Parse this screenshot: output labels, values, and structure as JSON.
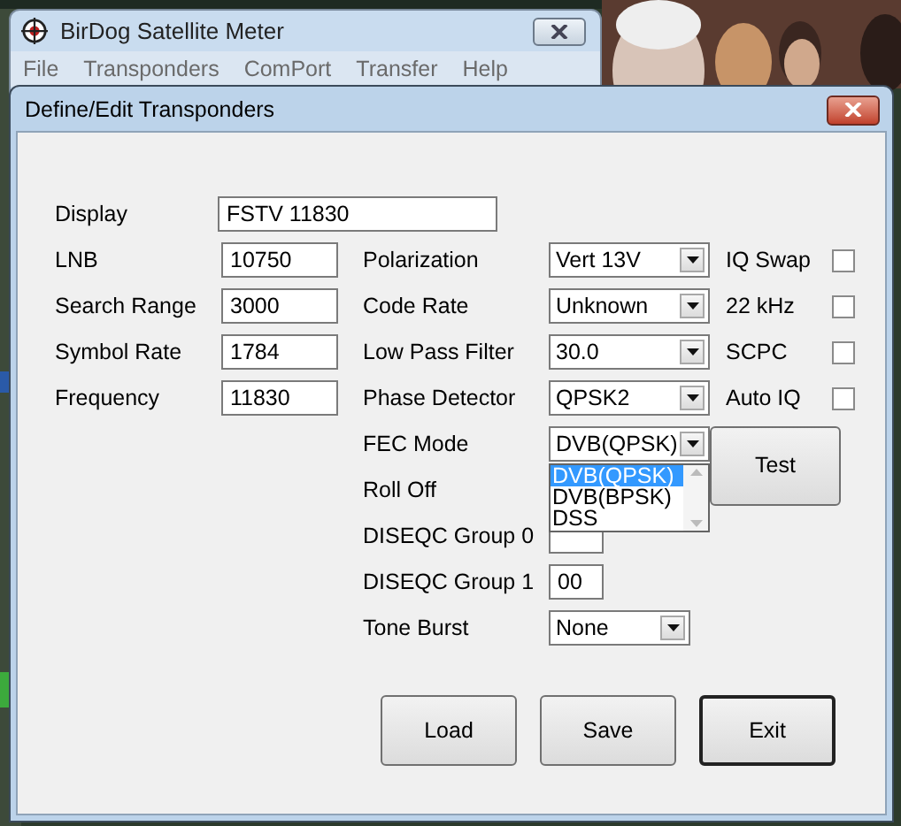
{
  "main_window": {
    "title": "BirDog Satellite Meter",
    "menu": [
      "File",
      "Transponders",
      "ComPort",
      "Transfer",
      "Help"
    ]
  },
  "dialog": {
    "title": "Define/Edit Transponders",
    "display": {
      "label": "Display",
      "value": "FSTV 11830"
    },
    "left_fields": [
      {
        "label": "LNB",
        "value": "10750"
      },
      {
        "label": "Search Range",
        "value": "3000"
      },
      {
        "label": "Symbol Rate",
        "value": "1784"
      },
      {
        "label": "Frequency",
        "value": "11830"
      }
    ],
    "right_fields": [
      {
        "label": "Polarization",
        "kind": "select",
        "value": "Vert 13V"
      },
      {
        "label": "Code Rate",
        "kind": "select",
        "value": "Unknown"
      },
      {
        "label": "Low Pass Filter",
        "kind": "select",
        "value": "30.0"
      },
      {
        "label": "Phase Detector",
        "kind": "select",
        "value": "QPSK2"
      },
      {
        "label": "FEC Mode",
        "kind": "open-select",
        "value": "DVB(QPSK)"
      },
      {
        "label": "Roll Off",
        "kind": "covered"
      },
      {
        "label": "DISEQC Group 0",
        "kind": "input"
      },
      {
        "label": "DISEQC Group 1",
        "kind": "input",
        "value": "00"
      },
      {
        "label": "Tone Burst",
        "kind": "short-select",
        "value": "None"
      }
    ],
    "checkboxes": [
      {
        "label": "IQ Swap",
        "checked": false
      },
      {
        "label": "22 kHz",
        "checked": false
      },
      {
        "label": "SCPC",
        "checked": false
      },
      {
        "label": "Auto IQ",
        "checked": false
      }
    ],
    "dropdown_options": [
      {
        "label": "DVB(QPSK)",
        "selected": true
      },
      {
        "label": "DVB(BPSK)",
        "selected": false
      },
      {
        "label": "DSS",
        "selected": false
      }
    ],
    "test_button": "Test",
    "buttons": [
      {
        "label": "Load",
        "default": false
      },
      {
        "label": "Save",
        "default": false
      },
      {
        "label": "Exit",
        "default": true
      }
    ]
  }
}
